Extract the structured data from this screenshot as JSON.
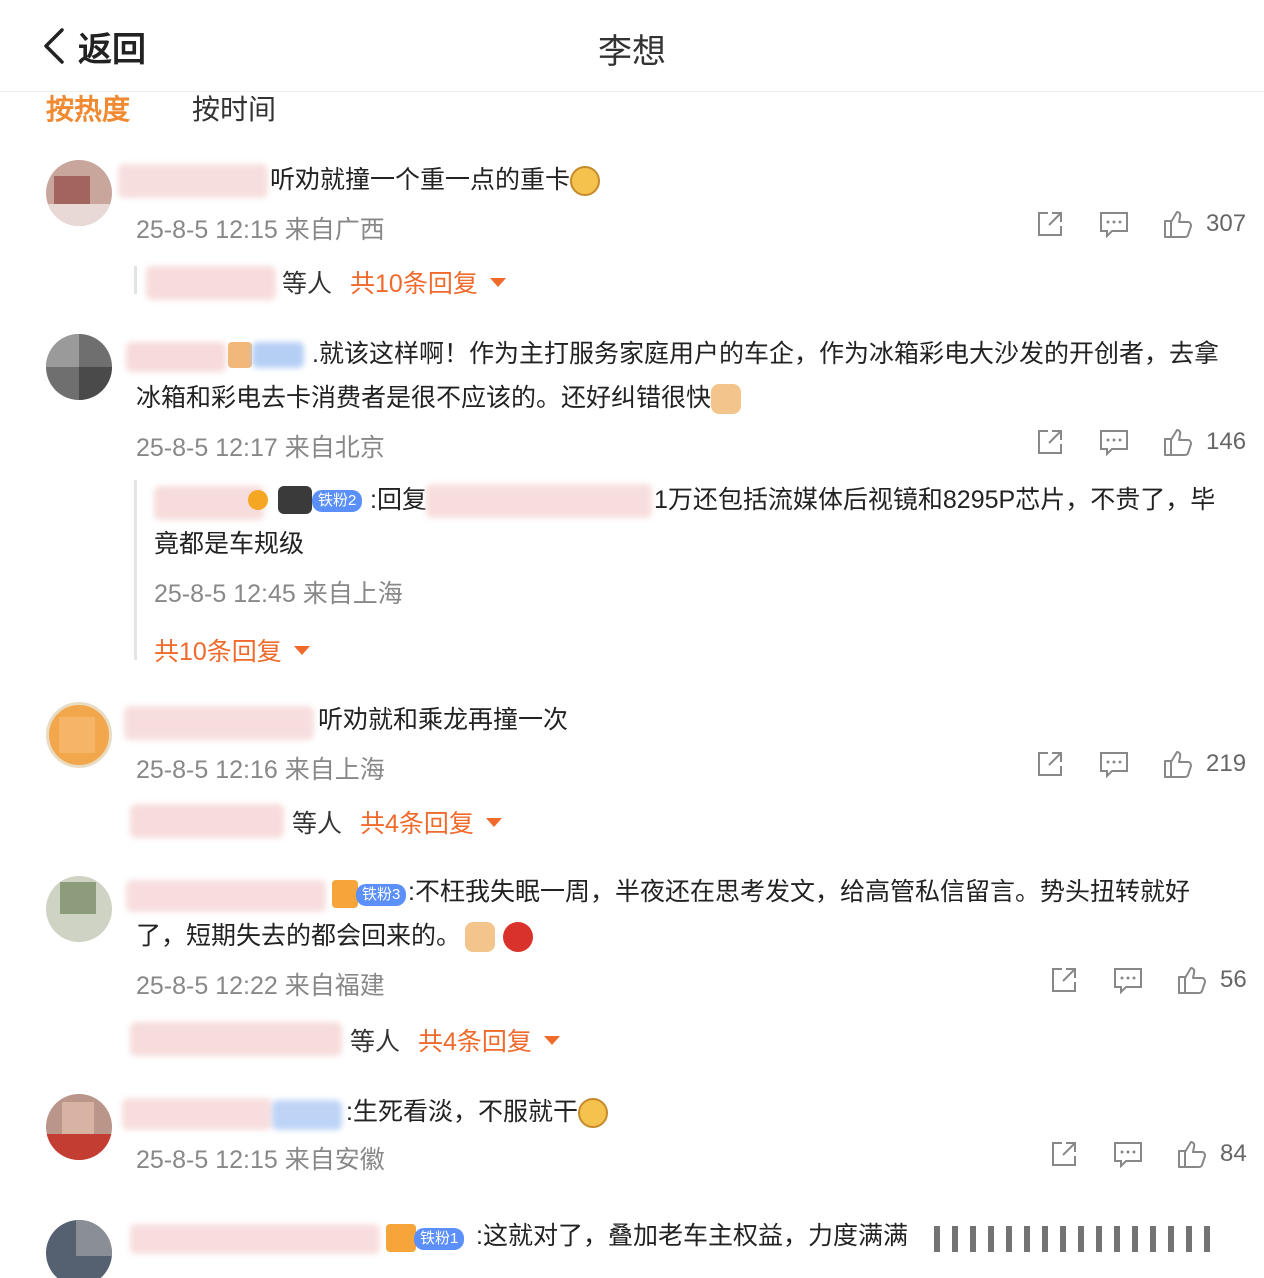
{
  "header": {
    "back_label": "返回",
    "title": "李想"
  },
  "sort": {
    "hot": "按热度",
    "time": "按时间"
  },
  "comments": [
    {
      "text": "听劝就撞一个重一点的重卡",
      "meta": "25-8-5 12:15 来自广西",
      "likes": "307",
      "more_suffix": "等人",
      "more_count": "共10条回复"
    },
    {
      "text": ".就该这样啊！作为主打服务家庭用户的车企，作为冰箱彩电大沙发的开创者，去拿冰箱和彩电去卡消费者是很不应该的。还好纠错很快",
      "meta": "25-8-5 12:17 来自北京",
      "likes": "146",
      "reply": {
        "badge": "铁粉2",
        "prefix": ":回复",
        "text": "1万还包括流媒体后视镜和8295P芯片，不贵了，毕竟都是车规级",
        "meta": "25-8-5 12:45 来自上海"
      },
      "more_count": "共10条回复"
    },
    {
      "text": "听劝就和乘龙再撞一次",
      "meta": "25-8-5 12:16 来自上海",
      "likes": "219",
      "more_suffix": "等人",
      "more_count": "共4条回复"
    },
    {
      "badge": "铁粉3",
      "text": ":不枉我失眠一周，半夜还在思考发文，给高管私信留言。势头扭转就好了，短期失去的都会回来的。",
      "meta": "25-8-5 12:22 来自福建",
      "likes": "56",
      "more_suffix": "等人",
      "more_count": "共4条回复"
    },
    {
      "text": ":生死看淡，不服就干",
      "meta": "25-8-5 12:15 来自安徽",
      "likes": "84"
    },
    {
      "badge": "铁粉1",
      "text": ":这就对了，叠加老车主权益，力度满满"
    }
  ]
}
